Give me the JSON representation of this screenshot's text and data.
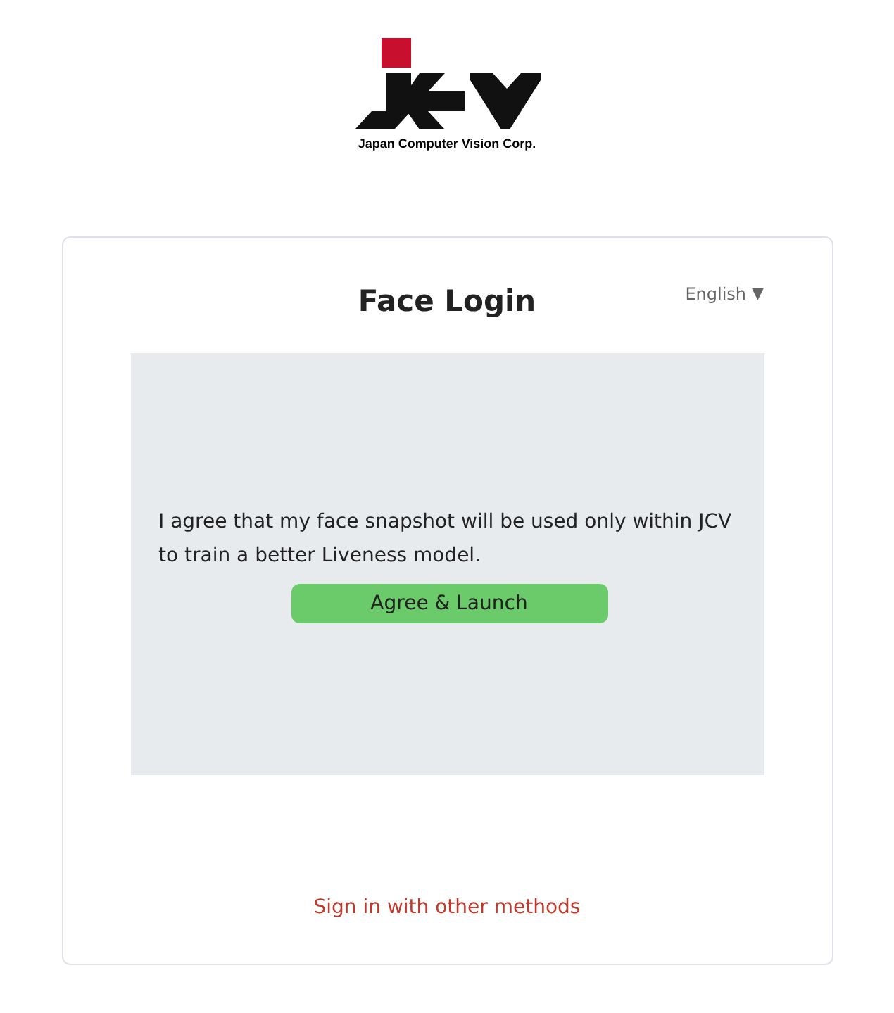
{
  "logo": {
    "tagline": "Japan Computer Vision Corp."
  },
  "card": {
    "title": "Face Login",
    "language": "English",
    "language_caret": "▼",
    "consent_text": "I agree that my face snapshot will be used only within JCV to train a better Liveness model.",
    "agree_button": "Agree & Launch",
    "other_methods_link": "Sign in with other methods"
  }
}
